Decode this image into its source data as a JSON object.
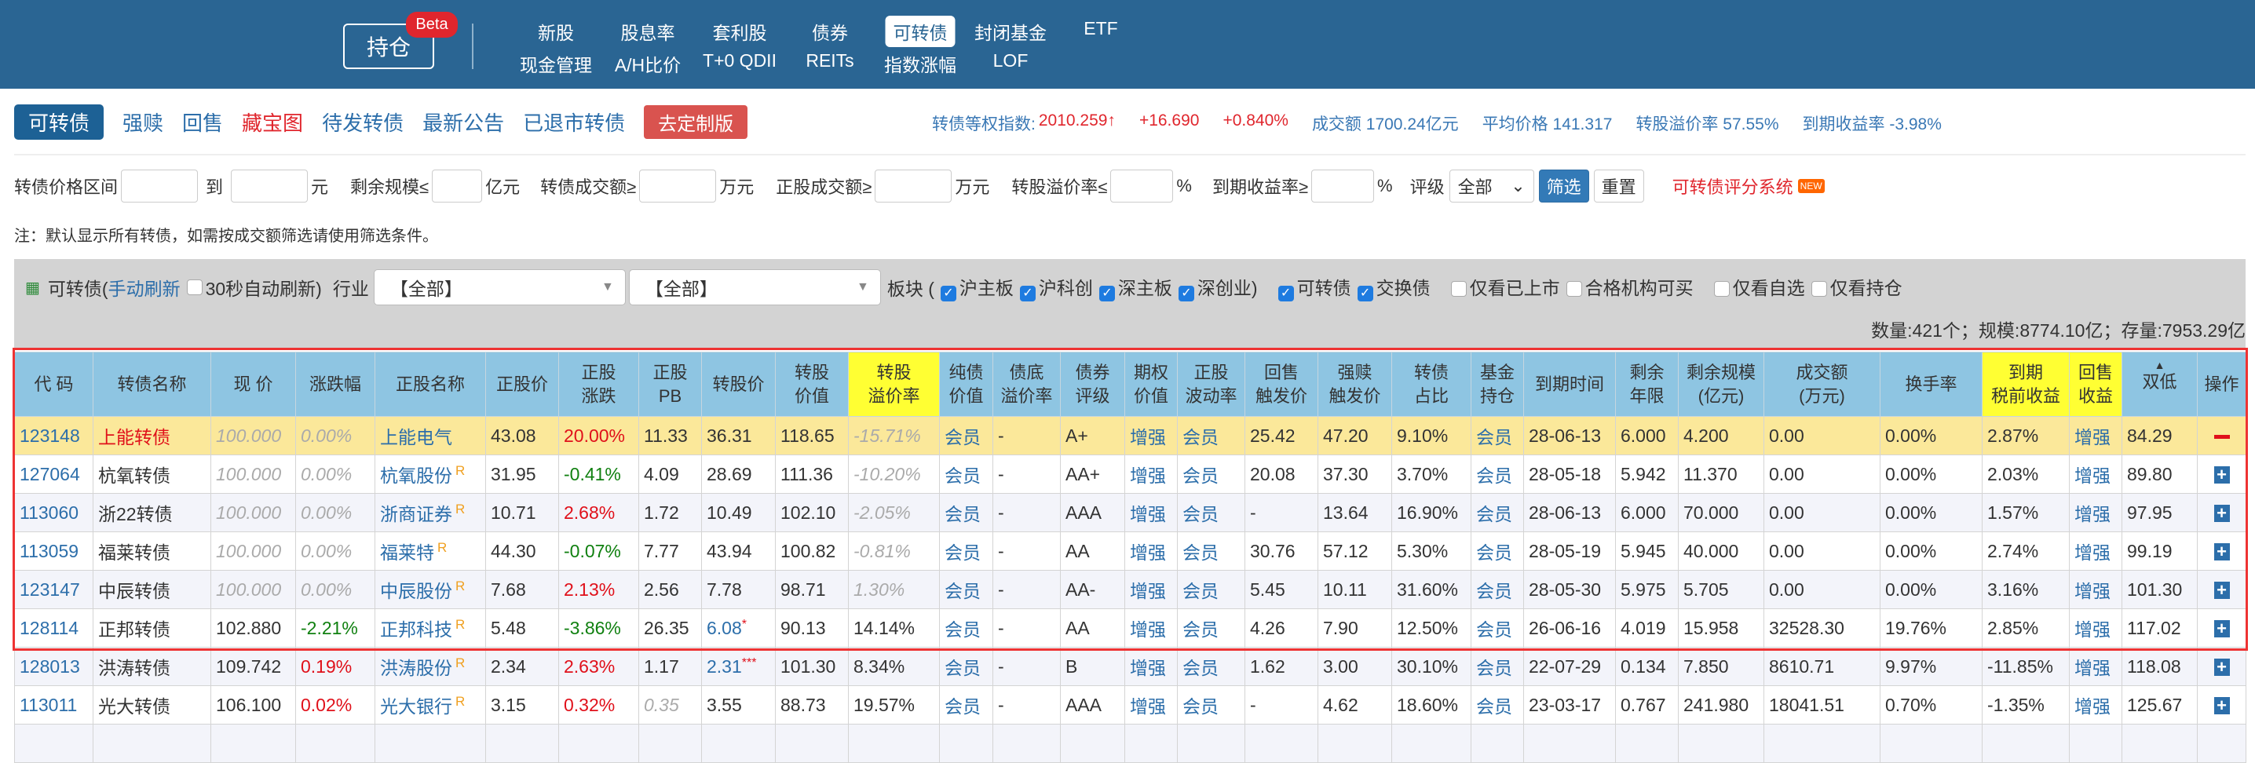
{
  "header": {
    "hold_label": "持仓",
    "beta": "Beta",
    "nav_row1": [
      "新股",
      "股息率",
      "套利股",
      "债券",
      "可转债",
      "封闭基金",
      "ETF"
    ],
    "nav_row2": [
      "现金管理",
      "A/H比价",
      "T+0 QDII",
      "REITs",
      "指数涨幅",
      "LOF"
    ],
    "active": "可转债"
  },
  "tabs": [
    "可转债",
    "强赎",
    "回售",
    "藏宝图",
    "待发转债",
    "最新公告",
    "已退市转债"
  ],
  "custom_button": "去定制版",
  "stats": {
    "index_label": "转债等权指数:",
    "index_value": "2010.259↑",
    "change": "+16.690",
    "change_pct": "+0.840%",
    "turnover": "成交额 1700.24亿元",
    "avg_price": "平均价格 141.317",
    "premium": "转股溢价率 57.55%",
    "ytm": "到期收益率 -3.98%"
  },
  "filters": {
    "price_range": "转债价格区间",
    "to": "到",
    "yuan": "元",
    "remain": "剩余规模≤",
    "yi_yuan": "亿元",
    "bond_turnover": "转债成交额≥",
    "wan_yuan": "万元",
    "stock_turnover": "正股成交额≥",
    "wan_yuan2": "万元",
    "premium": "转股溢价率≤",
    "pct": "%",
    "ytm": "到期收益率≥",
    "pct2": "%",
    "rating": "评级",
    "rating_value": "全部",
    "filter_btn": "筛选",
    "reset_btn": "重置",
    "score_link": "可转债评分系统",
    "new_badge": "NEW"
  },
  "note": "注：默认显示所有转债，如需按成交额筛选请使用筛选条件。",
  "panel": {
    "title": "可转债(",
    "manual_refresh": "手动刷新",
    "auto_refresh": "30秒自动刷新)",
    "industry": "行业",
    "industry1": "【全部】",
    "industry2": "【全部】",
    "board": "板块 (",
    "checks": [
      {
        "label": "沪主板",
        "on": true
      },
      {
        "label": "沪科创",
        "on": true
      },
      {
        "label": "深主板",
        "on": true
      },
      {
        "label": "深创业)",
        "on": true
      },
      {
        "label": "可转债",
        "on": true
      },
      {
        "label": "交换债",
        "on": true
      },
      {
        "label": "仅看已上市",
        "on": false
      },
      {
        "label": "合格机构可买",
        "on": false
      },
      {
        "label": "仅看自选",
        "on": false
      },
      {
        "label": "仅看持仓",
        "on": false
      }
    ],
    "count": "数量:421个；规模:8774.10亿；存量:7953.29亿"
  },
  "table": {
    "headers": [
      "代 码",
      "转债名称",
      "现 价",
      "涨跌幅",
      "正股名称",
      "正股价",
      "正股\n涨跌",
      "正股\nPB",
      "转股价",
      "转股\n价值",
      "转股\n溢价率",
      "纯债\n价值",
      "债底\n溢价率",
      "债券\n评级",
      "期权\n价值",
      "正股\n波动率",
      "回售\n触发价",
      "强赎\n触发价",
      "转债\n占比",
      "基金\n持仓",
      "到期时间",
      "剩余\n年限",
      "剩余规模\n(亿元)",
      "成交额\n(万元)",
      "换手率",
      "到期\n税前收益",
      "回售\n收益",
      "双低",
      "操作"
    ],
    "yellow_headers": [
      10,
      25,
      26
    ],
    "sort_col": 27,
    "rows": [
      {
        "cls": "hl",
        "op": "minus",
        "cells": [
          "123148",
          "上能转债",
          "100.000",
          "0.00%",
          "上能电气",
          "43.08",
          "20.00%",
          "11.33",
          "36.31",
          "118.65",
          "-15.71%",
          "会员",
          "-",
          "A+",
          "增强",
          "会员",
          "25.42",
          "47.20",
          "9.10%",
          "会员",
          "28-06-13",
          "6.000",
          "4.200",
          "0.00",
          "0.00%",
          "2.87%",
          "增强",
          "84.29"
        ],
        "tones": {
          "0": "link",
          "1": "red",
          "2": "m",
          "3": "m",
          "4": "link",
          "6": "up",
          "10": "m"
        },
        "r": false
      },
      {
        "cls": "",
        "op": "plus",
        "cells": [
          "127064",
          "杭氧转债",
          "100.000",
          "0.00%",
          "杭氧股份",
          "31.95",
          "-0.41%",
          "4.09",
          "28.69",
          "111.36",
          "-10.20%",
          "会员",
          "-",
          "AA+",
          "增强",
          "会员",
          "20.08",
          "37.30",
          "3.70%",
          "会员",
          "28-05-18",
          "5.942",
          "11.370",
          "0.00",
          "0.00%",
          "2.03%",
          "增强",
          "89.80"
        ],
        "tones": {
          "0": "link",
          "2": "m",
          "3": "m",
          "4": "link",
          "6": "down",
          "10": "m"
        },
        "r": true
      },
      {
        "cls": "alt",
        "op": "plus",
        "cells": [
          "113060",
          "浙22转债",
          "100.000",
          "0.00%",
          "浙商证券",
          "10.71",
          "2.68%",
          "1.72",
          "10.49",
          "102.10",
          "-2.05%",
          "会员",
          "-",
          "AAA",
          "增强",
          "会员",
          "-",
          "13.64",
          "16.90%",
          "会员",
          "28-06-13",
          "6.000",
          "70.000",
          "0.00",
          "0.00%",
          "1.57%",
          "增强",
          "97.95"
        ],
        "tones": {
          "0": "link",
          "2": "m",
          "3": "m",
          "4": "link",
          "6": "up",
          "10": "m"
        },
        "r": true
      },
      {
        "cls": "",
        "op": "plus",
        "cells": [
          "113059",
          "福莱转债",
          "100.000",
          "0.00%",
          "福莱特",
          "44.30",
          "-0.07%",
          "7.77",
          "43.94",
          "100.82",
          "-0.81%",
          "会员",
          "-",
          "AA",
          "增强",
          "会员",
          "30.76",
          "57.12",
          "5.30%",
          "会员",
          "28-05-19",
          "5.945",
          "40.000",
          "0.00",
          "0.00%",
          "2.74%",
          "增强",
          "99.19"
        ],
        "tones": {
          "0": "link",
          "2": "m",
          "3": "m",
          "4": "link",
          "6": "down",
          "10": "m"
        },
        "r": true
      },
      {
        "cls": "alt",
        "op": "plus",
        "cells": [
          "123147",
          "中辰转债",
          "100.000",
          "0.00%",
          "中辰股份",
          "7.68",
          "2.13%",
          "2.56",
          "7.78",
          "98.71",
          "1.30%",
          "会员",
          "-",
          "AA-",
          "增强",
          "会员",
          "5.45",
          "10.11",
          "31.60%",
          "会员",
          "28-05-30",
          "5.975",
          "5.705",
          "0.00",
          "0.00%",
          "3.16%",
          "增强",
          "101.30"
        ],
        "tones": {
          "0": "link",
          "2": "m",
          "3": "m",
          "4": "link",
          "6": "up",
          "10": "m"
        },
        "r": true
      },
      {
        "cls": "",
        "op": "plus",
        "cells": [
          "128114",
          "正邦转债",
          "102.880",
          "-2.21%",
          "正邦科技",
          "5.48",
          "-3.86%",
          "26.35",
          "6.08",
          "90.13",
          "14.14%",
          "会员",
          "-",
          "AA",
          "增强",
          "会员",
          "4.26",
          "7.90",
          "12.50%",
          "会员",
          "26-06-16",
          "4.019",
          "15.958",
          "32528.30",
          "19.76%",
          "2.85%",
          "增强",
          "117.02"
        ],
        "tones": {
          "0": "link",
          "3": "down",
          "4": "link",
          "6": "down",
          "8": "link"
        },
        "r": true,
        "mark": "*"
      },
      {
        "cls": "alt",
        "op": "plus",
        "cells": [
          "128013",
          "洪涛转债",
          "109.742",
          "0.19%",
          "洪涛股份",
          "2.34",
          "2.63%",
          "1.17",
          "2.31",
          "101.30",
          "8.34%",
          "会员",
          "-",
          "B",
          "增强",
          "会员",
          "1.62",
          "3.00",
          "30.10%",
          "会员",
          "22-07-29",
          "0.134",
          "7.850",
          "8610.71",
          "9.97%",
          "-11.85%",
          "增强",
          "118.08"
        ],
        "tones": {
          "0": "link",
          "3": "up",
          "4": "link",
          "6": "up",
          "8": "link"
        },
        "r": true,
        "mark": "***"
      },
      {
        "cls": "",
        "op": "plus",
        "cells": [
          "113011",
          "光大转债",
          "106.100",
          "0.02%",
          "光大银行",
          "3.15",
          "0.32%",
          "0.35",
          "3.55",
          "88.73",
          "19.57%",
          "会员",
          "-",
          "AAA",
          "增强",
          "会员",
          "-",
          "4.62",
          "18.60%",
          "会员",
          "23-03-17",
          "0.767",
          "241.980",
          "18041.51",
          "0.70%",
          "-1.35%",
          "增强",
          "125.67"
        ],
        "tones": {
          "0": "link",
          "3": "up",
          "4": "link",
          "6": "up",
          "7": "m"
        },
        "r": true
      }
    ]
  }
}
